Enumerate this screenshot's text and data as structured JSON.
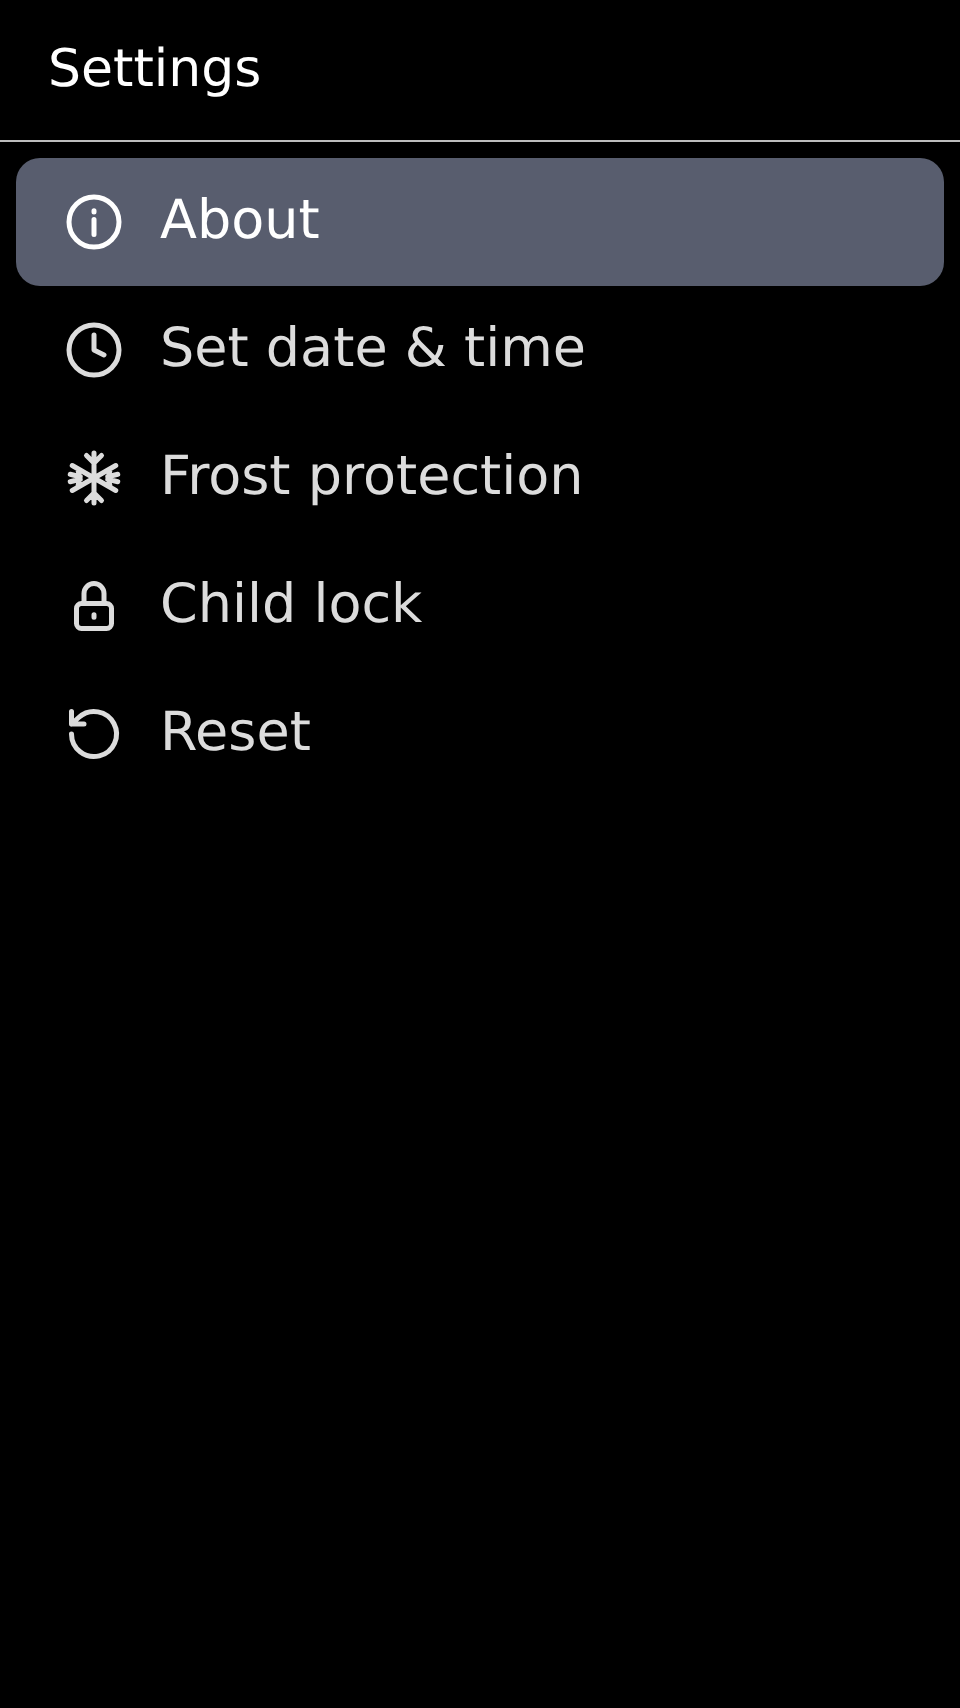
{
  "header": {
    "title": "Settings"
  },
  "menu": [
    {
      "label": "About",
      "selected": true
    },
    {
      "label": "Set date & time",
      "selected": false
    },
    {
      "label": "Frost protection",
      "selected": false
    },
    {
      "label": "Child lock",
      "selected": false
    },
    {
      "label": "Reset",
      "selected": false
    }
  ]
}
